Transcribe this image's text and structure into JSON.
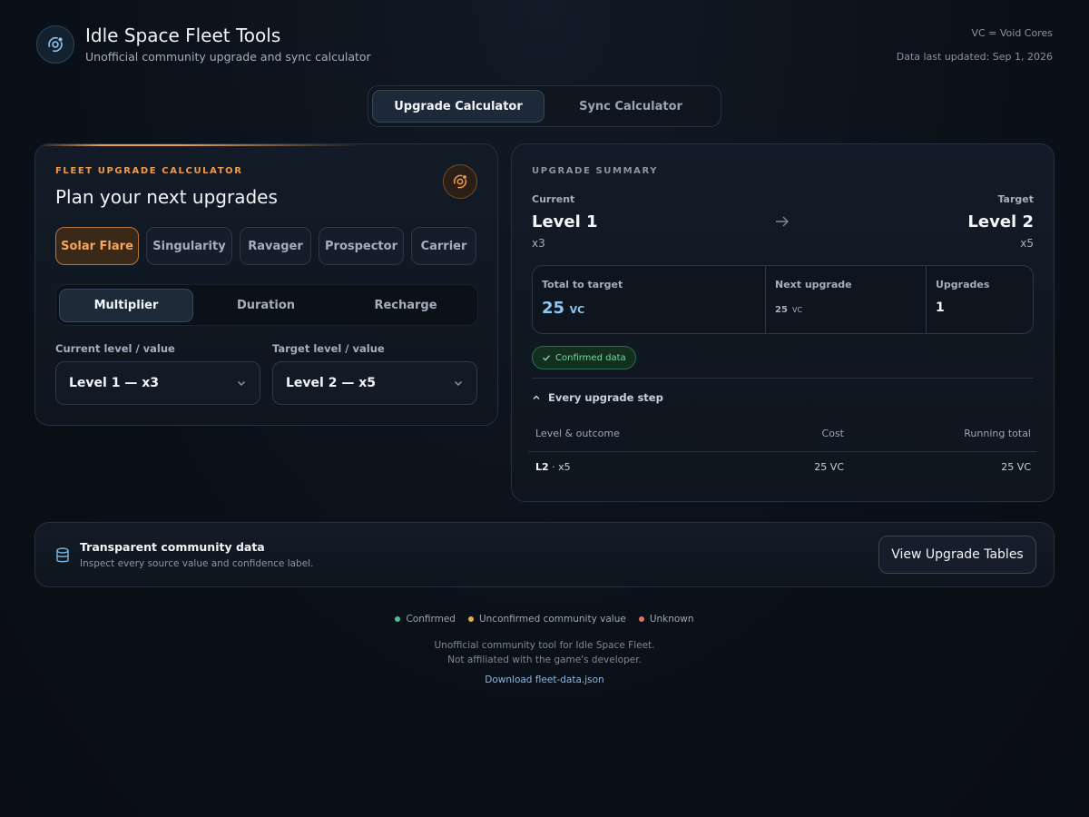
{
  "header": {
    "title": "Idle Space Fleet Tools",
    "subtitle": "Unofficial community upgrade and sync calculator",
    "legend_note": "VC = Void Cores",
    "updated": "Data last updated: Sep 1, 2026",
    "logo_icon": "orbit-icon"
  },
  "tabs": [
    {
      "label": "Upgrade Calculator",
      "active": true
    },
    {
      "label": "Sync Calculator",
      "active": false
    }
  ],
  "calculator": {
    "eyebrow": "FLEET UPGRADE CALCULATOR",
    "title": "Plan your next upgrades",
    "icon": "orbit-icon",
    "ships": [
      {
        "label": "Solar Flare",
        "active": true
      },
      {
        "label": "Singularity",
        "active": false
      },
      {
        "label": "Ravager",
        "active": false
      },
      {
        "label": "Prospector",
        "active": false
      },
      {
        "label": "Carrier",
        "active": false
      }
    ],
    "stats": [
      {
        "label": "Multiplier",
        "active": true
      },
      {
        "label": "Duration",
        "active": false
      },
      {
        "label": "Recharge",
        "active": false
      }
    ],
    "current_label": "Current level / value",
    "current_value": "Level 1 — x3",
    "target_label": "Target level / value",
    "target_value": "Level 2 — x5"
  },
  "summary": {
    "eyebrow": "UPGRADE SUMMARY",
    "current_label": "Current",
    "current_level": "Level 1",
    "current_mult": "x3",
    "target_label": "Target",
    "target_level": "Level 2",
    "target_mult": "x5",
    "total_label": "Total to target",
    "total_value": "25",
    "total_unit": "VC",
    "next_label": "Next upgrade",
    "next_value": "25",
    "next_unit": "VC",
    "upgrades_label": "Upgrades",
    "upgrades_value": "1",
    "badge": "Confirmed data",
    "steps_toggle": "Every upgrade step",
    "table_headers": [
      "Level & outcome",
      "Cost",
      "Running total"
    ],
    "rows": [
      {
        "level": "L2",
        "outcome": " · x5",
        "cost": "25 VC",
        "running": "25 VC"
      }
    ]
  },
  "community": {
    "title": "Transparent community data",
    "subtitle": "Inspect every source value and confidence label.",
    "button": "View Upgrade Tables",
    "icon": "database-icon"
  },
  "footer": {
    "legend": [
      {
        "label": "Confirmed",
        "color": "#4fbf8f"
      },
      {
        "label": "Unconfirmed community value",
        "color": "#e8a84a"
      },
      {
        "label": "Unknown",
        "color": "#e0735a"
      }
    ],
    "disclaimer_1": "Unofficial community tool for Idle Space Fleet.",
    "disclaimer_2": "Not affiliated with the game's developer.",
    "download": "Download fleet-data.json"
  }
}
